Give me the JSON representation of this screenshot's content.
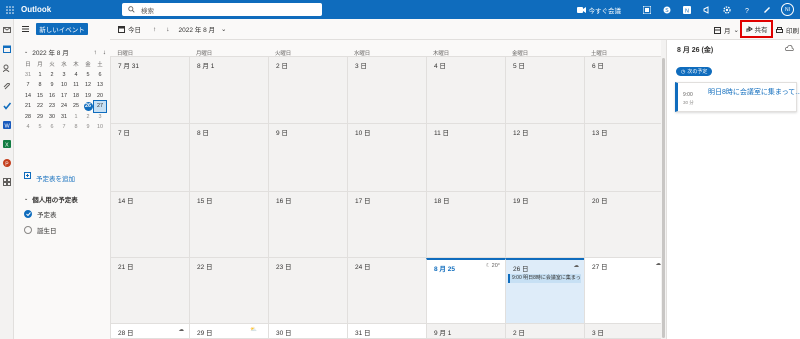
{
  "app": {
    "name": "Outlook",
    "search_placeholder": "検索",
    "meet_now": "今すぐ会議",
    "avatar_initials": "NI"
  },
  "pane": {
    "new_event": "新しいイベント",
    "mini_title": "2022 年 8 月",
    "weekdays": [
      "日",
      "月",
      "火",
      "水",
      "木",
      "金",
      "土"
    ],
    "weeks": [
      [
        "31",
        "1",
        "2",
        "3",
        "4",
        "5",
        "6"
      ],
      [
        "7",
        "8",
        "9",
        "10",
        "11",
        "12",
        "13"
      ],
      [
        "14",
        "15",
        "16",
        "17",
        "18",
        "19",
        "20"
      ],
      [
        "21",
        "22",
        "23",
        "24",
        "25",
        "26",
        "27"
      ],
      [
        "28",
        "29",
        "30",
        "31",
        "1",
        "2",
        "3"
      ],
      [
        "4",
        "5",
        "6",
        "7",
        "8",
        "9",
        "10"
      ]
    ],
    "add_calendar": "予定表を追加",
    "section": "個人用の予定表",
    "calendars": [
      {
        "label": "予定表",
        "checked": true
      },
      {
        "label": "誕生日",
        "checked": false
      }
    ]
  },
  "toolbar": {
    "today": "今日",
    "range": "2022 年 8 月",
    "view": "月",
    "share": "共有",
    "print": "印刷"
  },
  "grid": {
    "days_of_week": [
      "日曜日",
      "月曜日",
      "火曜日",
      "水曜日",
      "木曜日",
      "金曜日",
      "土曜日"
    ],
    "rows": [
      [
        "7 月 31",
        "8 月 1",
        "2 日",
        "3 日",
        "4 日",
        "5 日",
        "6 日"
      ],
      [
        "7 日",
        "8 日",
        "9 日",
        "10 日",
        "11 日",
        "12 日",
        "13 日"
      ],
      [
        "14 日",
        "15 日",
        "16 日",
        "17 日",
        "18 日",
        "19 日",
        "20 日"
      ],
      [
        "21 日",
        "22 日",
        "23 日",
        "24 日",
        "8 月 25",
        "26 日",
        "27 日"
      ],
      [
        "28 日",
        "29 日",
        "30 日",
        "31 日",
        "9 月 1",
        "2 日",
        "3 日"
      ]
    ],
    "weather_25": "20°",
    "event": "9:00 明日8時に会議室に集まって"
  },
  "right_pane": {
    "date": "8 月 26 (金)",
    "next_label": "次の予定",
    "event_time": "9:00",
    "event_duration": "30 分",
    "event_title": "明日8時に会議室に集まって..."
  },
  "colors": {
    "brand": "#0f6cbd",
    "highlight": "#e00000"
  }
}
